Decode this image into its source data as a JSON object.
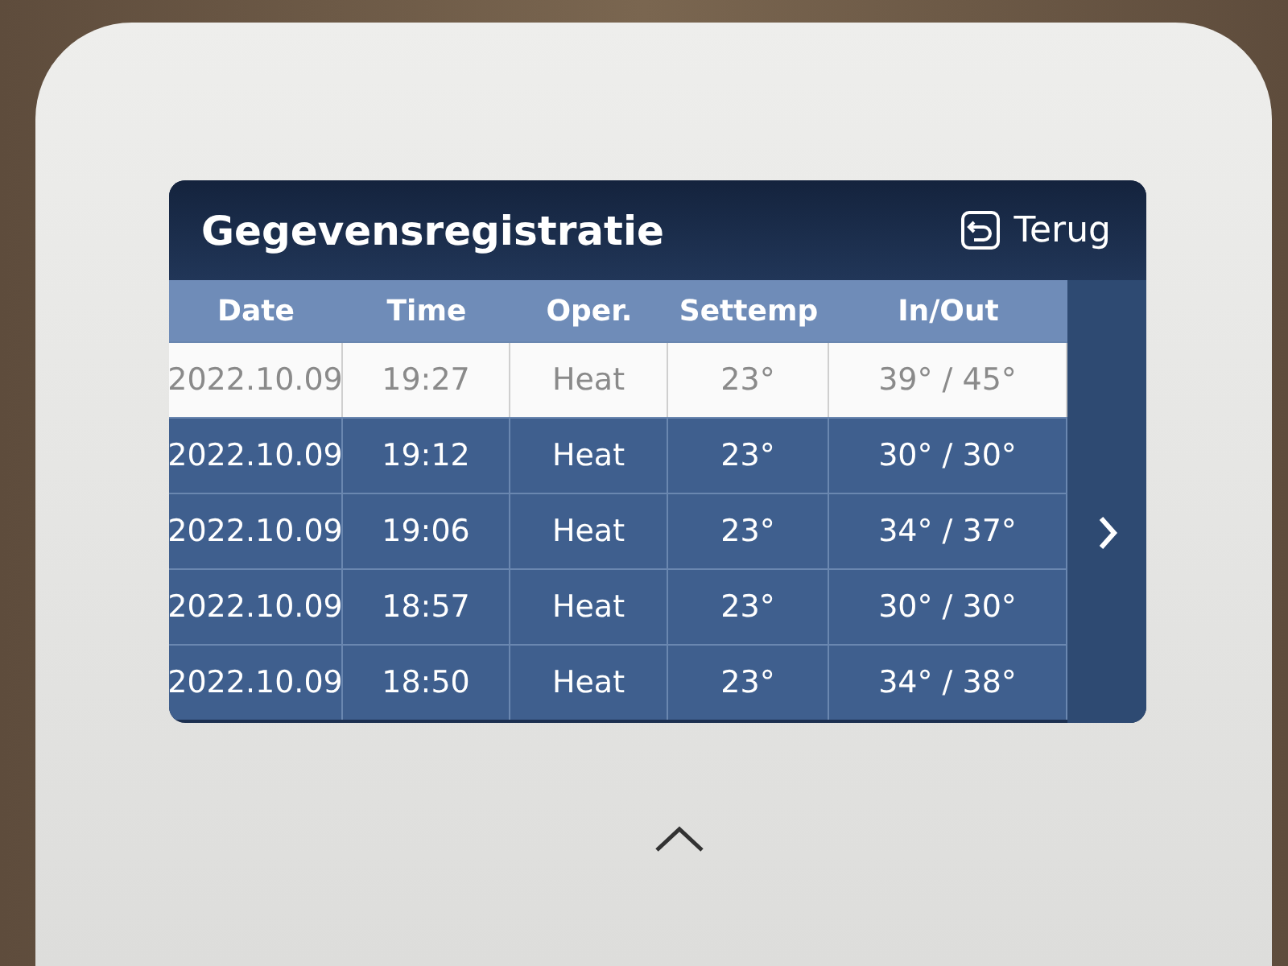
{
  "screen": {
    "title": "Gegevensregistratie",
    "back_button": {
      "label": "Terug"
    },
    "table": {
      "columns": [
        "Date",
        "Time",
        "Oper.",
        "Settemp",
        "In/Out"
      ],
      "rows": [
        {
          "cells": [
            "2022.10.09",
            "19:27",
            "Heat",
            "23°",
            "39° / 45°"
          ],
          "selected": true
        },
        {
          "cells": [
            "2022.10.09",
            "19:12",
            "Heat",
            "23°",
            "30° / 30°"
          ],
          "selected": false
        },
        {
          "cells": [
            "2022.10.09",
            "19:06",
            "Heat",
            "23°",
            "34° / 37°"
          ],
          "selected": false
        },
        {
          "cells": [
            "2022.10.09",
            "18:57",
            "Heat",
            "23°",
            "30° / 30°"
          ],
          "selected": false
        },
        {
          "cells": [
            "2022.10.09",
            "18:50",
            "Heat",
            "23°",
            "34° / 38°"
          ],
          "selected": false
        }
      ]
    }
  }
}
